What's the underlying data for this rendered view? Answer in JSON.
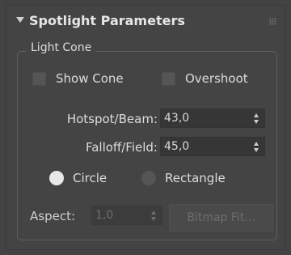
{
  "rollout": {
    "title": "Spotlight Parameters",
    "group_label": "Light Cone"
  },
  "checkboxes": {
    "show_cone": {
      "label": "Show Cone",
      "checked": false
    },
    "overshoot": {
      "label": "Overshoot",
      "checked": false
    }
  },
  "fields": {
    "hotspot": {
      "label": "Hotspot/Beam:",
      "value": "43,0"
    },
    "falloff": {
      "label": "Falloff/Field:",
      "value": "45,0"
    },
    "aspect": {
      "label": "Aspect:",
      "value": "1,0",
      "enabled": false
    }
  },
  "shape": {
    "circle_label": "Circle",
    "rectangle_label": "Rectangle",
    "selected": "Circle"
  },
  "buttons": {
    "bitmap_fit_label": "Bitmap Fit...",
    "bitmap_fit_enabled": false
  },
  "icons": {
    "collapse": "triangle-down-icon",
    "grip": "grip-dots-icon",
    "spinner": "spinner-arrows-icon"
  },
  "colors": {
    "panel_bg": "#444444",
    "field_bg": "#363636",
    "text": "#dcdcdc",
    "disabled_text": "#6e6e6e"
  }
}
